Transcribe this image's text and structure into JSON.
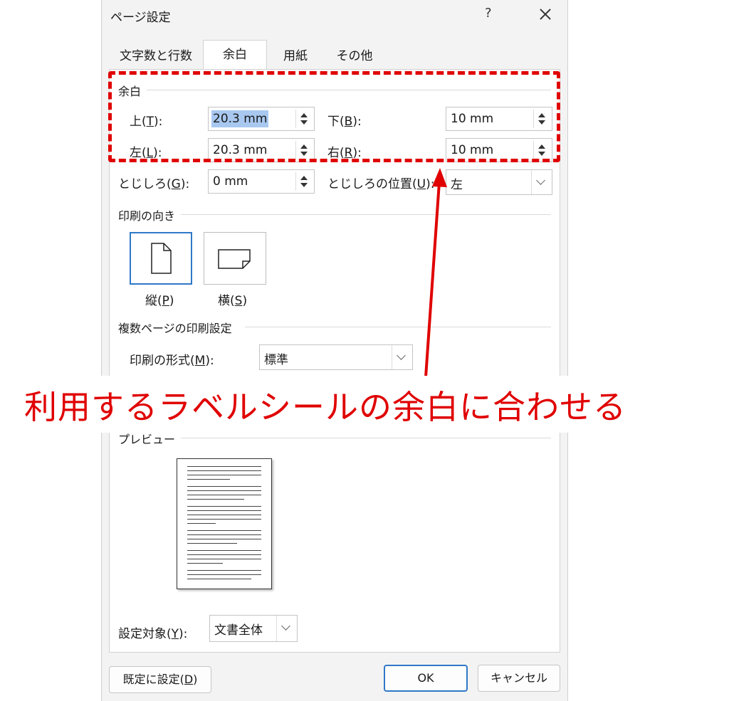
{
  "dialog": {
    "title": "ページ設定",
    "help": "?",
    "tabs": [
      {
        "label": "文字数と行数",
        "active": false
      },
      {
        "label": "余白",
        "active": true
      },
      {
        "label": "用紙",
        "active": false
      },
      {
        "label": "その他",
        "active": false
      }
    ],
    "margins": {
      "group_title": "余白",
      "top": {
        "label": "上(",
        "key": "T",
        "suffix": "):",
        "value": "20.3 mm"
      },
      "bottom": {
        "label": "下(",
        "key": "B",
        "suffix": "):",
        "value": "10 mm"
      },
      "left": {
        "label": "左(",
        "key": "L",
        "suffix": "):",
        "value": "20.3 mm"
      },
      "right": {
        "label": "右(",
        "key": "R",
        "suffix": "):",
        "value": "10 mm"
      },
      "gutter": {
        "label": "とじしろ(",
        "key": "G",
        "suffix": "):",
        "value": "0 mm"
      },
      "gutter_pos": {
        "label": "とじしろの位置(",
        "key": "U",
        "suffix": "):",
        "value": "左"
      }
    },
    "orientation": {
      "group_title": "印刷の向き",
      "portrait": {
        "label": "縦(",
        "key": "P",
        "suffix": ")",
        "selected": true
      },
      "landscape": {
        "label": "横(",
        "key": "S",
        "suffix": ")",
        "selected": false
      }
    },
    "multi_page": {
      "group_title": "複数ページの印刷設定",
      "format": {
        "label": "印刷の形式(",
        "key": "M",
        "suffix": "):",
        "value": "標準"
      }
    },
    "preview": {
      "group_title": "プレビュー"
    },
    "apply_to": {
      "label": "設定対象(",
      "key": "Y",
      "suffix": "):",
      "value": "文書全体"
    },
    "buttons": {
      "default": {
        "label": "既定に設定(",
        "key": "D",
        "suffix": ")"
      },
      "ok": "OK",
      "cancel": "キャンセル"
    }
  },
  "annotation": {
    "text": "利用するラベルシールの余白に合わせる",
    "color": "#e00000"
  },
  "colors": {
    "accent": "#2f78c8",
    "selection": "#a8c8f0"
  }
}
